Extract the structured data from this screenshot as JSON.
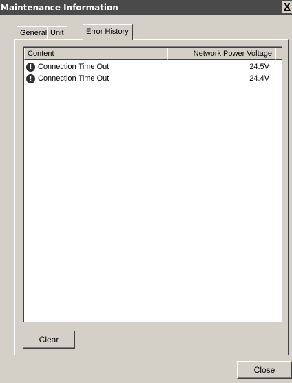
{
  "window": {
    "title": "Maintenance Information",
    "close_glyph": "X"
  },
  "tabs": [
    {
      "label": "General",
      "active": false
    },
    {
      "label": "Unit",
      "active": false
    },
    {
      "label": "Error History",
      "active": true
    }
  ],
  "error_list": {
    "columns": [
      "Content",
      "Network Power Voltage"
    ],
    "rows": [
      {
        "icon": "error-icon",
        "content": "Connection Time Out",
        "voltage": "24.5V"
      },
      {
        "icon": "error-icon",
        "content": "Connection Time Out",
        "voltage": "24.4V"
      }
    ]
  },
  "buttons": {
    "clear": "Clear",
    "close": "Close"
  },
  "colors": {
    "titlebar": "#4a4a4a",
    "face": "#d4d0c8",
    "list_bg": "#ffffff"
  }
}
